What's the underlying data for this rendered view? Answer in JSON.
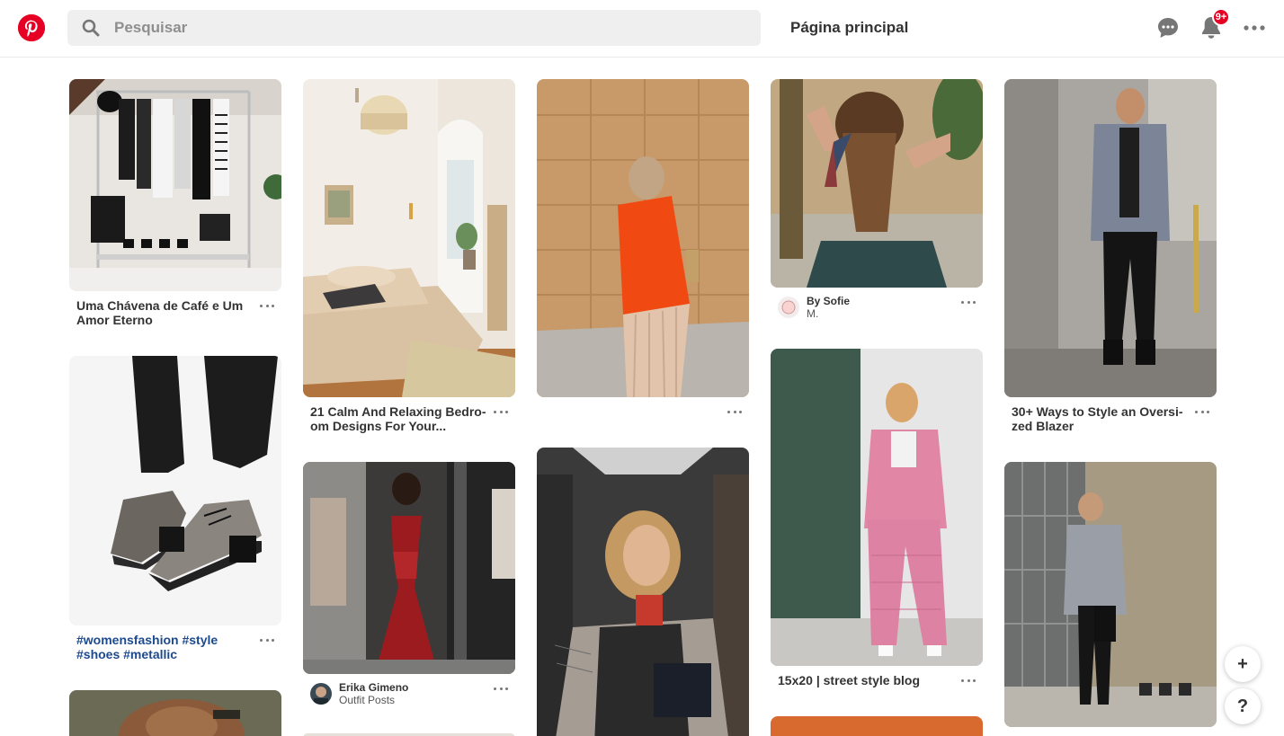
{
  "header": {
    "search_placeholder": "Pesquisar",
    "home_label": "Página principal",
    "notifications_badge": "9+",
    "brand_color": "#e60023"
  },
  "pins": [
    {
      "title": "Uma Chávena de Café e Um Amor Eterno"
    },
    {
      "title": "#womensfashion #style #shoes #metallic"
    },
    {
      "title": "21 Calm And Relaxing Bedro-om Designs For Your..."
    },
    {
      "user": "Erika Gimeno",
      "board": "Outfit Posts"
    },
    {
      "title": ""
    },
    {
      "user": "By Sofie",
      "board": "M."
    },
    {
      "title": "15x20 | street style blog"
    },
    {
      "title": "30+ Ways to Style an Oversi-zed Blazer"
    }
  ],
  "fab": {
    "add": "+",
    "help": "?"
  }
}
